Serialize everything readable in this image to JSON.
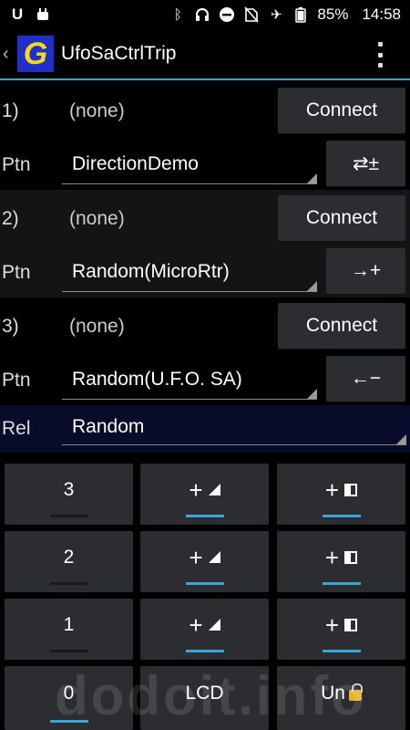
{
  "status_bar": {
    "battery": "85%",
    "time": "14:58"
  },
  "app": {
    "back_glyph": "‹",
    "logo_letter": "G",
    "title": "UfoSaCtrlTrip"
  },
  "devices": [
    {
      "number": "1)",
      "device": "(none)",
      "connect_label": "Connect",
      "pattern_label": "Ptn",
      "pattern": "DirectionDemo",
      "mode_label": "⇄±"
    },
    {
      "number": "2)",
      "device": "(none)",
      "connect_label": "Connect",
      "pattern_label": "Ptn",
      "pattern": "Random(MicroRtr)",
      "mode_label": "→+"
    },
    {
      "number": "3)",
      "device": "(none)",
      "connect_label": "Connect",
      "pattern_label": "Ptn",
      "pattern": "Random(U.F.O. SA)",
      "mode_label": "←−"
    }
  ],
  "rel": {
    "label": "Rel",
    "value": "Random"
  },
  "keypad": {
    "rows": [
      {
        "num": "3",
        "plus_a": "+",
        "plus_b": "+"
      },
      {
        "num": "2",
        "plus_a": "+",
        "plus_b": "+"
      },
      {
        "num": "1",
        "plus_a": "+",
        "plus_b": "+"
      }
    ],
    "bottom": {
      "zero": "0",
      "lcd": "LCD",
      "unlock": "Un"
    }
  },
  "watermark": "dodoit.info",
  "colors": {
    "accent": "#35a6d8",
    "button": "#2b2d30",
    "rel_bg": "#080c2a"
  }
}
